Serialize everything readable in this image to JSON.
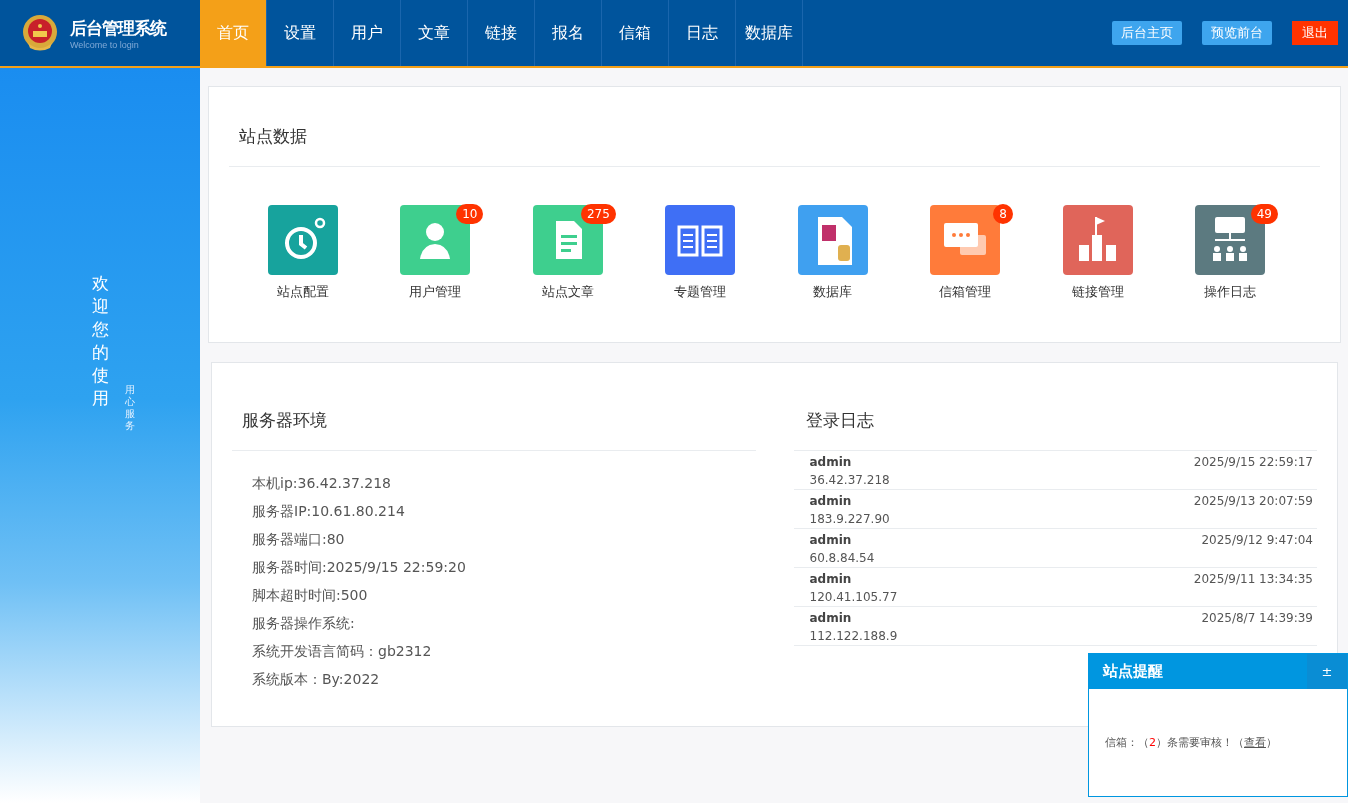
{
  "header": {
    "title": "后台管理系统",
    "subtitle": "Welcome to login",
    "nav": [
      {
        "label": "首页",
        "selected": true
      },
      {
        "label": "设置",
        "selected": false
      },
      {
        "label": "用户",
        "selected": false
      },
      {
        "label": "文章",
        "selected": false
      },
      {
        "label": "链接",
        "selected": false
      },
      {
        "label": "报名",
        "selected": false
      },
      {
        "label": "信箱",
        "selected": false
      },
      {
        "label": "日志",
        "selected": false
      },
      {
        "label": "数据库",
        "selected": false
      }
    ],
    "actions": [
      {
        "label": "后台主页",
        "kind": "light"
      },
      {
        "label": "预览前台",
        "kind": "light"
      },
      {
        "label": "退出",
        "kind": "danger"
      }
    ]
  },
  "sidebar": {
    "welcome": "欢迎您的使用",
    "motto": "用心服务"
  },
  "site_data": {
    "title": "站点数据",
    "tiles": [
      {
        "label": "站点配置",
        "color": "#17a39d"
      },
      {
        "label": "用户管理",
        "color": "#3ecf8e",
        "badge": "10"
      },
      {
        "label": "站点文章",
        "color": "#3ecf8e",
        "badge": "275"
      },
      {
        "label": "专题管理",
        "color": "#3f6ff5"
      },
      {
        "label": "数据库",
        "color": "#3fa0f0"
      },
      {
        "label": "信箱管理",
        "color": "#ff7b3a",
        "badge": "8"
      },
      {
        "label": "链接管理",
        "color": "#e0655a"
      },
      {
        "label": "操作日志",
        "color": "#5c7a80",
        "badge": "49"
      }
    ]
  },
  "server": {
    "title": "服务器环境",
    "lines": [
      "本机ip:36.42.37.218",
      "服务器IP:10.61.80.214",
      "服务器端口:80",
      "服务器时间:2025/9/15 22:59:20",
      "脚本超时时间:500",
      "服务器操作系统:",
      "系统开发语言简码：gb2312",
      "系统版本：By:2022"
    ]
  },
  "login_log": {
    "title": "登录日志",
    "rows": [
      {
        "user": "admin",
        "time": "2025/9/15 22:59:17",
        "ip": "36.42.37.218"
      },
      {
        "user": "admin",
        "time": "2025/9/13 20:07:59",
        "ip": "183.9.227.90"
      },
      {
        "user": "admin",
        "time": "2025/9/12 9:47:04",
        "ip": "60.8.84.54"
      },
      {
        "user": "admin",
        "time": "2025/9/11 13:34:35",
        "ip": "120.41.105.77"
      },
      {
        "user": "admin",
        "time": "2025/8/7 14:39:39",
        "ip": "112.122.188.9"
      }
    ]
  },
  "reminder": {
    "title": "站点提醒",
    "toggle": "±",
    "before": "信箱：（",
    "count": "2",
    "middle": "）条需要审核！（",
    "link": "查看",
    "after": "）"
  }
}
